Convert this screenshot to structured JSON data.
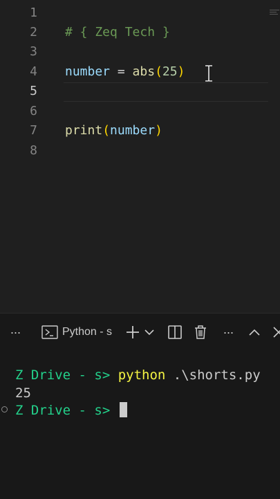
{
  "editor": {
    "lines": [
      {
        "n": "1"
      },
      {
        "n": "2",
        "comment": "# { Zeq Tech }"
      },
      {
        "n": "3"
      },
      {
        "n": "4",
        "var": "number",
        "op": " = ",
        "fn": "abs",
        "open": "(",
        "num": "25",
        "close": ")"
      },
      {
        "n": "5"
      },
      {
        "n": "6"
      },
      {
        "n": "7",
        "fn": "print",
        "open": "(",
        "var": "number",
        "close": ")"
      },
      {
        "n": "8"
      }
    ]
  },
  "panel": {
    "more_left": "···",
    "terminal_tab_label": "Python - s",
    "add_icon": "plus-icon",
    "dropdown_icon": "chevron-down-icon",
    "split_icon": "split-terminal-icon",
    "trash_icon": "trash-icon",
    "more_right": "···",
    "maximize_icon": "chevron-up-icon",
    "close_icon": "close-icon"
  },
  "terminal": {
    "line1_prompt": "Z Drive - s> ",
    "line1_cmd": "python",
    "line1_arg": " .\\shorts.py",
    "line2_output": "25",
    "line3_prompt": "Z Drive - s> "
  },
  "colors": {
    "prompt": "#23d18b",
    "command": "#f5f543",
    "comment": "#6a9955",
    "variable": "#9cdcfe",
    "function": "#dcdcaa",
    "number": "#b5cea8"
  }
}
